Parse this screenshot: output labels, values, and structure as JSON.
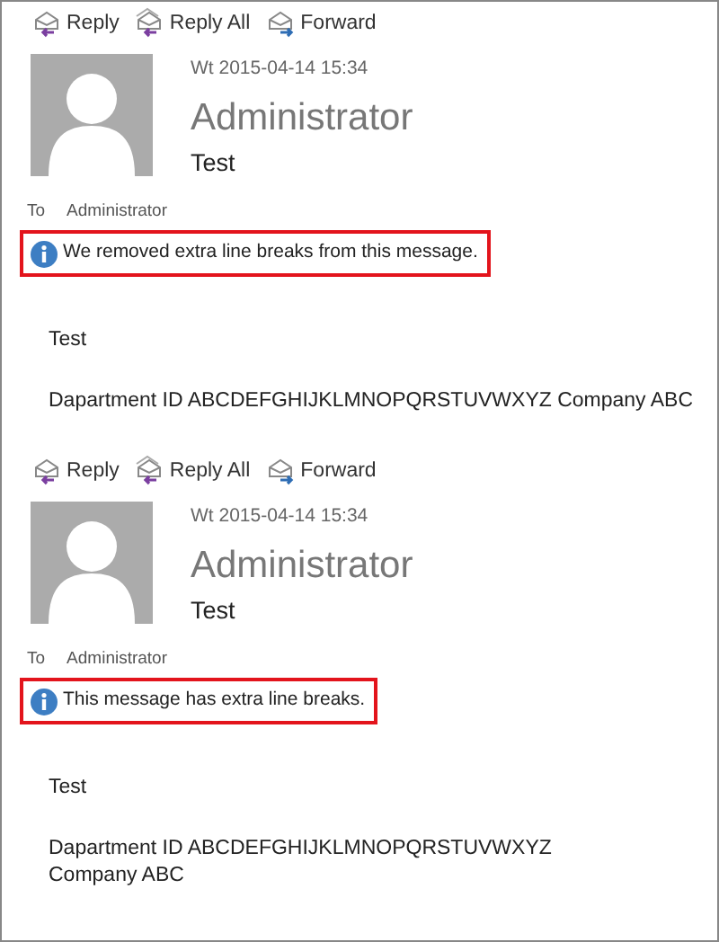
{
  "messages": [
    {
      "actions": [
        {
          "label": "Reply",
          "kind": "reply"
        },
        {
          "label": "Reply All",
          "kind": "reply-all"
        },
        {
          "label": "Forward",
          "kind": "forward"
        }
      ],
      "date": "Wt 2015-04-14 15:34",
      "sender": "Administrator",
      "subject": "Test",
      "to_label": "To",
      "to": "Administrator",
      "info": "We removed extra line breaks from this message.",
      "body": [
        [
          "Test"
        ],
        [
          "Dapartment ID ABCDEFGHIJKLMNOPQRSTUVWXYZ Company ABC"
        ]
      ]
    },
    {
      "actions": [
        {
          "label": "Reply",
          "kind": "reply"
        },
        {
          "label": "Reply All",
          "kind": "reply-all"
        },
        {
          "label": "Forward",
          "kind": "forward"
        }
      ],
      "date": "Wt 2015-04-14 15:34",
      "sender": "Administrator",
      "subject": "Test",
      "to_label": "To",
      "to": "Administrator",
      "info": "This message has extra line breaks.",
      "body": [
        [
          "Test"
        ],
        [
          "Dapartment ID ABCDEFGHIJKLMNOPQRSTUVWXYZ",
          "Company ABC"
        ]
      ]
    }
  ]
}
